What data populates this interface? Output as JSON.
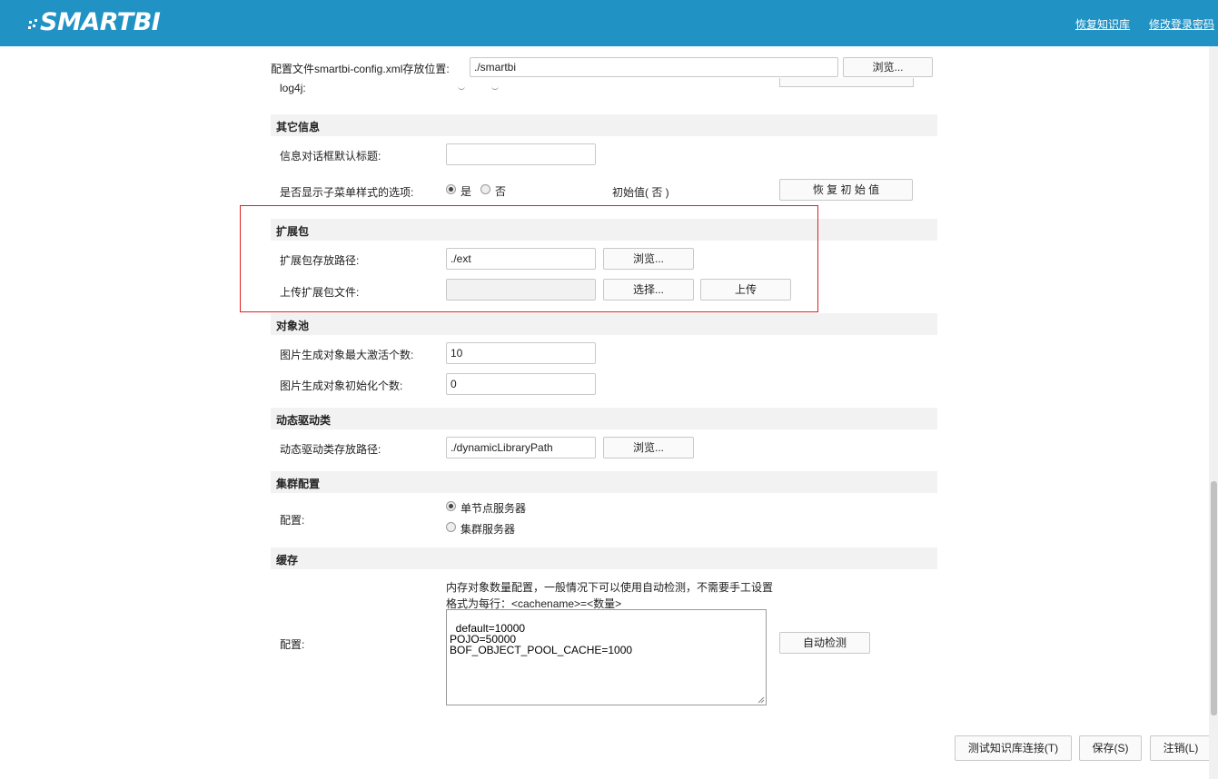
{
  "header": {
    "logo_text": "SMARTBI",
    "links": [
      "恢复知识库",
      "修改登录密码"
    ],
    "color": "#2192c4"
  },
  "config_file": {
    "label": "配置文件smartbi-config.xml存放位置:",
    "value": "./smartbi",
    "browse": "浏览..."
  },
  "log4j": {
    "label": "log4j:"
  },
  "other_info": {
    "title": "其它信息",
    "dialog_title_label": "信息对话框默认标题:",
    "dialog_title_value": "",
    "submenu_label": "是否显示子菜单样式的选项:",
    "yes": "是",
    "no": "否",
    "initial_value": "初始值( 否 )",
    "restore": "恢 复 初 始 值"
  },
  "extension": {
    "title": "扩展包",
    "path_label": "扩展包存放路径:",
    "path_value": "./ext",
    "browse": "浏览...",
    "upload_label": "上传扩展包文件:",
    "upload_value": "",
    "choose": "选择...",
    "upload": "上传",
    "highlight_color": "#e02020"
  },
  "object_pool": {
    "title": "对象池",
    "max_label": "图片生成对象最大激活个数:",
    "max_value": "10",
    "init_label": "图片生成对象初始化个数:",
    "init_value": "0"
  },
  "dynamic_driver": {
    "title": "动态驱动类",
    "path_label": "动态驱动类存放路径:",
    "path_value": "./dynamicLibraryPath",
    "browse": "浏览..."
  },
  "cluster": {
    "title": "集群配置",
    "label": "配置:",
    "single": "单节点服务器",
    "cluster": "集群服务器"
  },
  "cache": {
    "title": "缓存",
    "label": "配置:",
    "desc1": "内存对象数量配置，一般情况下可以使用自动检测，不需要手工设置",
    "desc2": "格式为每行：<cachename>=<数量>",
    "text": "default=10000\nPOJO=50000\nBOF_OBJECT_POOL_CACHE=1000",
    "auto_detect": "自动检测"
  },
  "footer": {
    "test": "测试知识库连接(T)",
    "save": "保存(S)",
    "logout": "注销(L)"
  }
}
